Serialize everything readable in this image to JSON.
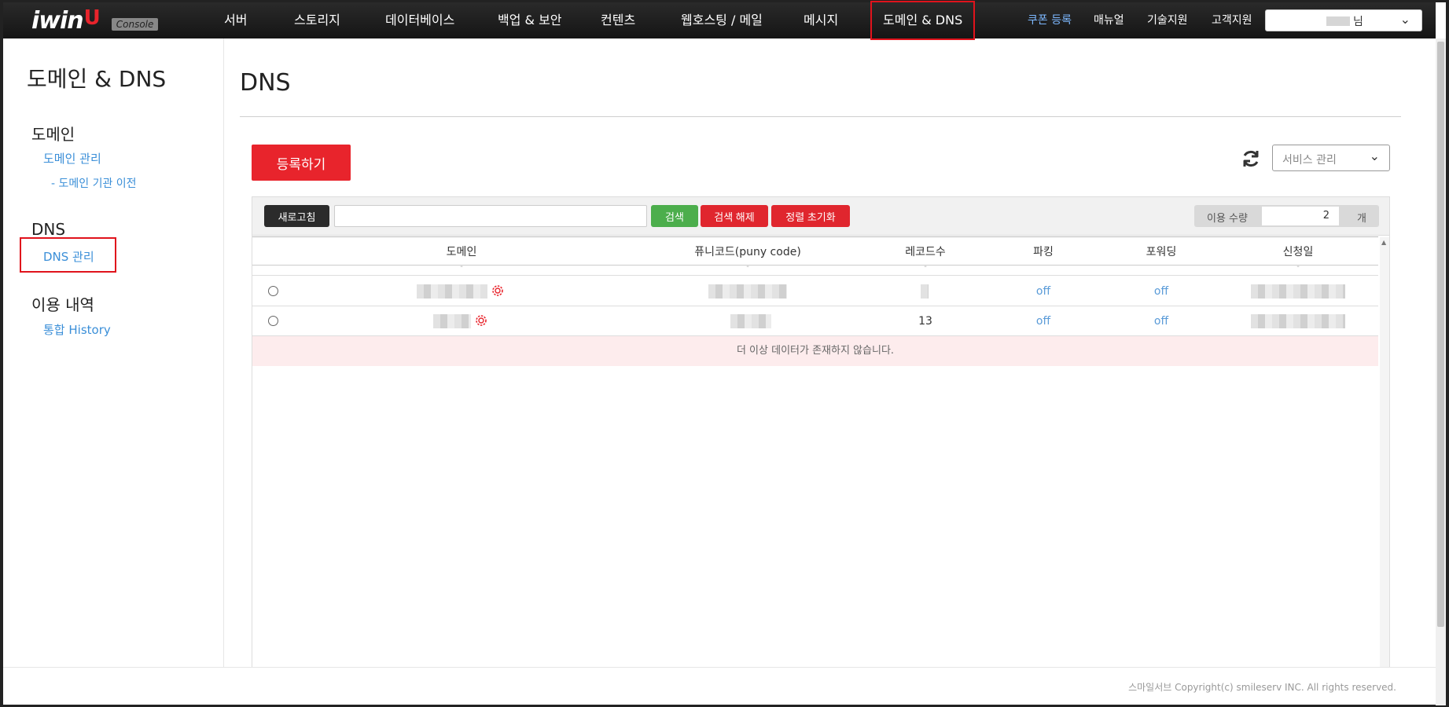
{
  "brand": {
    "logo_text": "iwin",
    "logo_badge": "Console",
    "logo_smile": "U"
  },
  "nav": {
    "items": [
      "서버",
      "스토리지",
      "데이터베이스",
      "백업 & 보안",
      "컨텐츠",
      "웹호스팅 / 메일",
      "메시지",
      "도메인 & DNS"
    ],
    "active_index": 7,
    "util": [
      "쿠폰 등록",
      "매뉴얼",
      "기술지원",
      "고객지원"
    ],
    "user_suffix": "님"
  },
  "sidebar": {
    "title": "도메인 & DNS",
    "groups": [
      {
        "label": "도메인",
        "links": [
          "도메인 관리",
          "- 도메인 기관 이전"
        ]
      },
      {
        "label": "DNS",
        "links": [
          "DNS 관리"
        ]
      },
      {
        "label": "이용 내역",
        "links": [
          "통합 History"
        ]
      }
    ]
  },
  "main": {
    "title": "DNS",
    "register_label": "등록하기",
    "service_select": "서비스 관리",
    "toolbar": {
      "refresh_label": "새로고침",
      "search_value": "",
      "search_label": "검색",
      "clear_label": "검색 해제",
      "reset_sort_label": "정렬 초기화",
      "usage_label": "이용 수량",
      "usage_value": "2",
      "usage_unit": "개"
    },
    "table": {
      "headers": [
        "도메인",
        "퓨니코드(puny code)",
        "레코드수",
        "파킹",
        "포워딩",
        "신청일"
      ],
      "filter_placeholder": "-",
      "rows": [
        {
          "domain": "",
          "puny": "",
          "records": "",
          "parking": "off",
          "forwarding": "off",
          "date": ""
        },
        {
          "domain": "",
          "puny": "",
          "records": "13",
          "parking": "off",
          "forwarding": "off",
          "date": ""
        }
      ],
      "empty_message": "더 이상 데이터가 존재하지 않습니다."
    }
  },
  "footer": {
    "copyright": "스마일서브 Copyright(c) smileserv INC. All rights reserved."
  },
  "colors": {
    "accent_red": "#e8242c",
    "link_blue": "#3b8fd8",
    "search_green": "#4cae4c",
    "nav_dark": "#1b1b1b"
  }
}
